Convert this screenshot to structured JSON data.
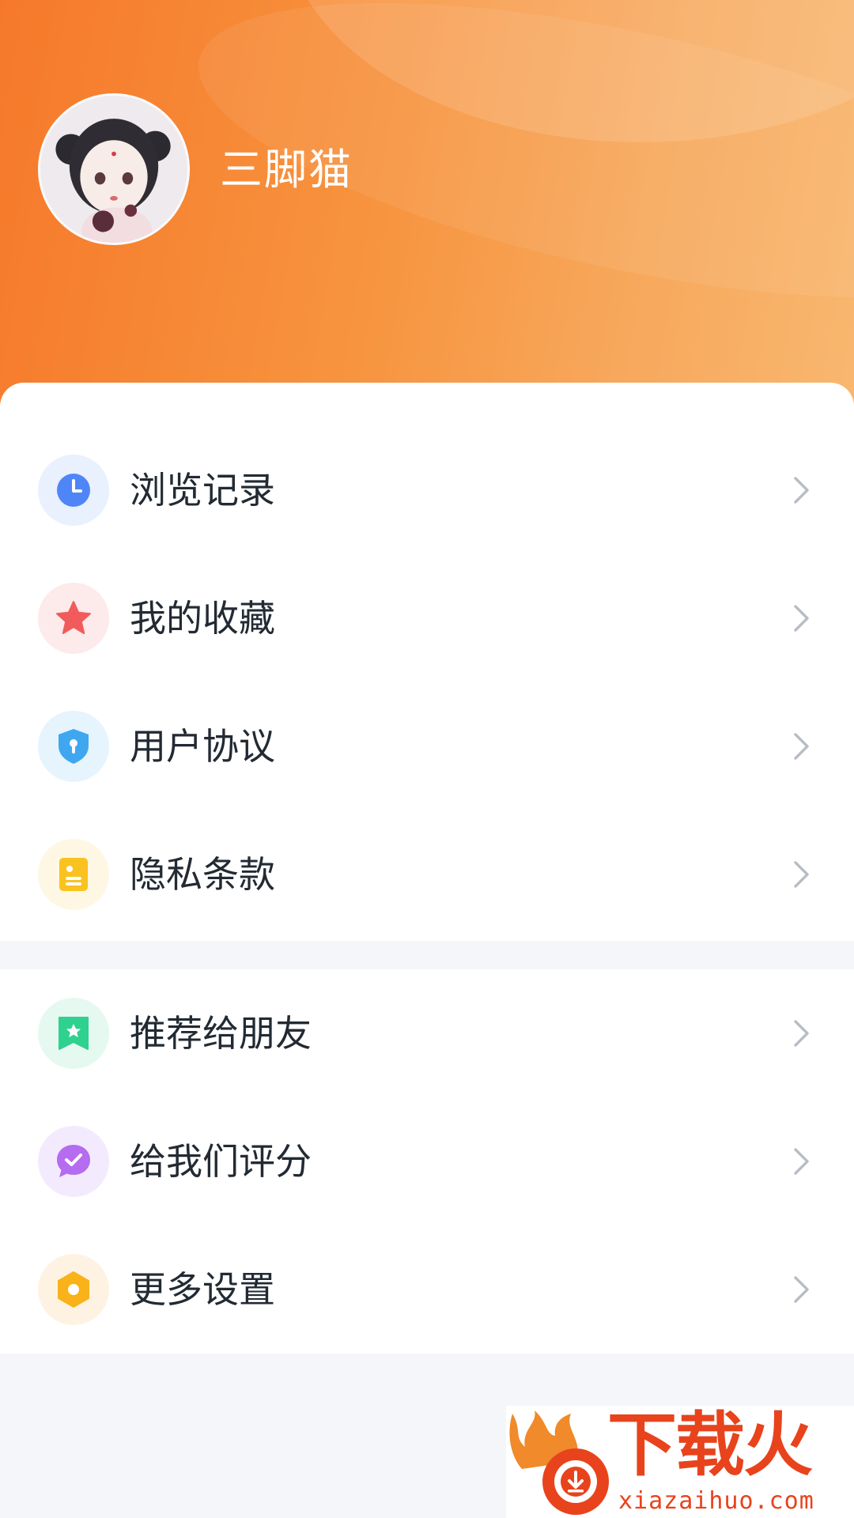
{
  "profile": {
    "username": "三脚猫"
  },
  "menu_primary": [
    {
      "label": "浏览记录",
      "icon": "clock-icon",
      "icon_color": "#4f86f7",
      "bg_color": "#e9f0fe"
    },
    {
      "label": "我的收藏",
      "icon": "star-icon",
      "icon_color": "#f25b5b",
      "bg_color": "#fdeaea"
    },
    {
      "label": "用户协议",
      "icon": "shield-icon",
      "icon_color": "#3fa7f0",
      "bg_color": "#e6f4fd"
    },
    {
      "label": "隐私条款",
      "icon": "document-icon",
      "icon_color": "#f9c21f",
      "bg_color": "#fef7e3"
    }
  ],
  "menu_secondary": [
    {
      "label": "推荐给朋友",
      "icon": "bookmark-star-icon",
      "icon_color": "#2fd18f",
      "bg_color": "#e5f9f0"
    },
    {
      "label": "给我们评分",
      "icon": "chat-check-icon",
      "icon_color": "#b56cf0",
      "bg_color": "#f4eafd"
    },
    {
      "label": "更多设置",
      "icon": "gear-hexagon-icon",
      "icon_color": "#f9b21a",
      "bg_color": "#fef3e3"
    }
  ],
  "watermark": {
    "title": "下载火",
    "url": "xiazaihuo.com"
  },
  "colors": {
    "header_gradient_start": "#f6792a",
    "header_gradient_end": "#f8b76f",
    "chevron": "#b8bcc6",
    "label_text": "#222a33",
    "watermark": "#e8431c"
  }
}
